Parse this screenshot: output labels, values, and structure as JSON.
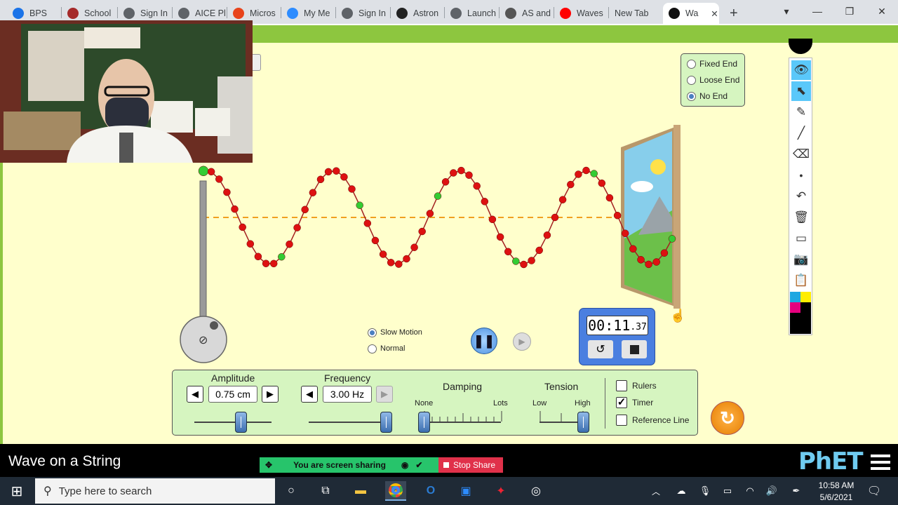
{
  "browser": {
    "tabs": [
      {
        "label": "BPS",
        "icon": "bps-icon",
        "color": "#1a73e8"
      },
      {
        "label": "School",
        "icon": "school-icon",
        "color": "#a52a2a"
      },
      {
        "label": "Sign In",
        "icon": "globe-icon",
        "color": "#5f6368"
      },
      {
        "label": "AICE Pl",
        "icon": "globe-icon",
        "color": "#5f6368"
      },
      {
        "label": "Micros",
        "icon": "office-icon",
        "color": "#e8431b"
      },
      {
        "label": "My Me",
        "icon": "zoom-icon",
        "color": "#2d8cff"
      },
      {
        "label": "Sign In",
        "icon": "globe-icon",
        "color": "#5f6368"
      },
      {
        "label": "Astron",
        "icon": "astronomy-icon",
        "color": "#222222"
      },
      {
        "label": "Launch",
        "icon": "globe-icon",
        "color": "#5f6368"
      },
      {
        "label": "AS and",
        "icon": "hexagon-icon",
        "color": "#555555"
      },
      {
        "label": "Waves",
        "icon": "youtube-icon",
        "color": "#ff0000"
      },
      {
        "label": "New Tab",
        "icon": "",
        "color": ""
      },
      {
        "label": "Wa",
        "icon": "phet-icon",
        "color": "#111111"
      }
    ],
    "new_tab": "+",
    "close_tab": "✕",
    "profile": "▾",
    "minimize": "—",
    "restore": "❐",
    "close": "✕"
  },
  "sim": {
    "title": "Wave on a String",
    "end_options": [
      {
        "label": "Fixed End",
        "selected": false
      },
      {
        "label": "Loose End",
        "selected": false
      },
      {
        "label": "No End",
        "selected": true
      }
    ],
    "speed_options": [
      {
        "label": "Slow Motion",
        "selected": true
      },
      {
        "label": "Normal",
        "selected": false
      }
    ],
    "timer": {
      "main": "00:11",
      "fraction": ".37"
    },
    "amplitude": {
      "label": "Amplitude",
      "value": "0.75 cm",
      "level": 0.6
    },
    "frequency": {
      "label": "Frequency",
      "value": "3.00 Hz",
      "level": 1.0
    },
    "damping": {
      "label": "Damping",
      "min": "None",
      "max": "Lots",
      "level": 0.0
    },
    "tension": {
      "label": "Tension",
      "min": "Low",
      "max": "High",
      "level": 1.0
    },
    "checkboxes": [
      {
        "label": "Rulers",
        "checked": false
      },
      {
        "label": "Timer",
        "checked": true
      },
      {
        "label": "Reference Line",
        "checked": false
      }
    ],
    "wave": {
      "amplitude_units": 0.75,
      "cycles": 3.7
    },
    "brand": "PhET"
  },
  "share": {
    "sharing_text": "You are screen sharing",
    "stop_text": "Stop Share"
  },
  "taskbar": {
    "search_placeholder": "Type here to search",
    "time": "10:58 AM",
    "date": "5/6/2021"
  }
}
